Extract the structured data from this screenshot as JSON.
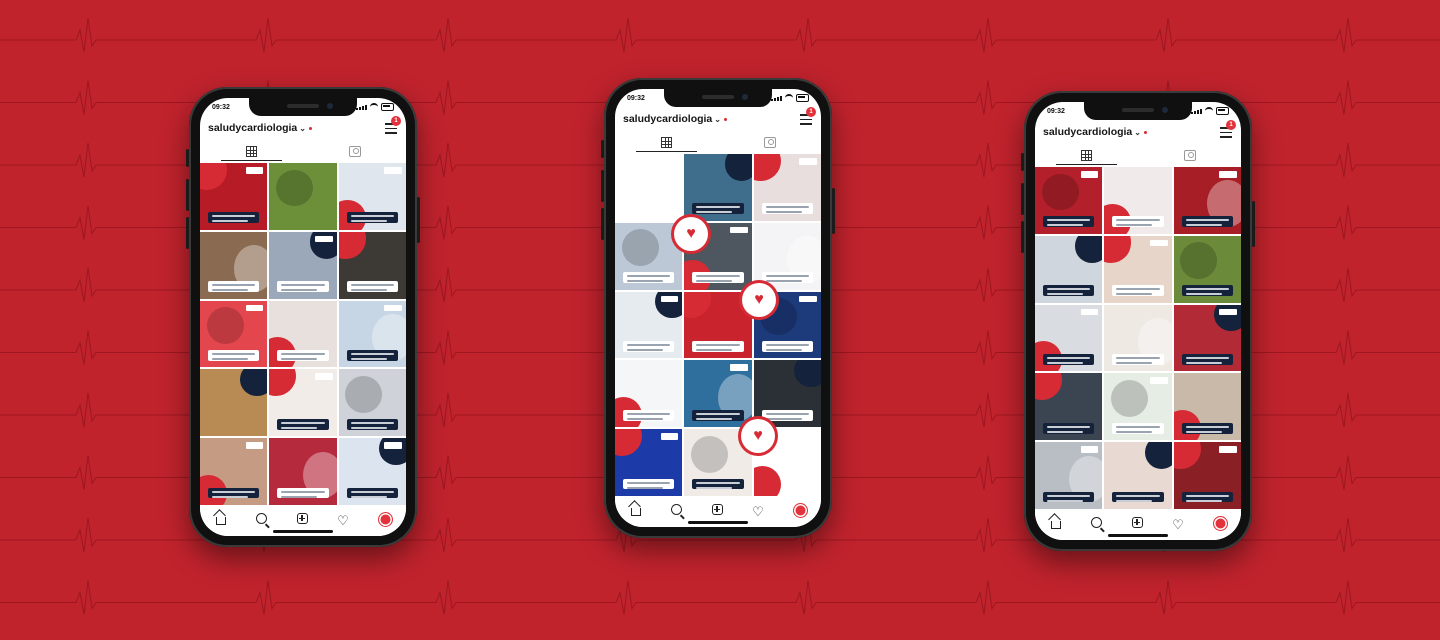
{
  "colors": {
    "background": "#c1232d",
    "accent": "#d62b34",
    "navy": "#14233b"
  },
  "phones": [
    {
      "time": "09:32",
      "username": "saludycardiologia",
      "notification_count": "1",
      "tabs": [
        "grid-icon",
        "tagged-icon"
      ],
      "nav": [
        "home-icon",
        "search-icon",
        "add-icon",
        "heart-icon",
        "profile-icon"
      ],
      "posts": [
        {
          "bg": "#b71c26",
          "cap": "dark"
        },
        {
          "bg": "#6c8f3a",
          "cap": "none"
        },
        {
          "bg": "#dfe6ee",
          "cap": "dark"
        },
        {
          "bg": "#8a6a50",
          "cap": "white"
        },
        {
          "bg": "#9aa8ba",
          "cap": "white"
        },
        {
          "bg": "#3d3a36",
          "cap": "white"
        },
        {
          "bg": "#e4464e",
          "cap": "white"
        },
        {
          "bg": "#e7e0dc",
          "cap": "white"
        },
        {
          "bg": "#c7d6e4",
          "cap": "dark"
        },
        {
          "bg": "#b88a54",
          "cap": "none"
        },
        {
          "bg": "#f1ece8",
          "cap": "dark"
        },
        {
          "bg": "#cfd3d9",
          "cap": "dark"
        },
        {
          "bg": "#c59b84",
          "cap": "dark"
        },
        {
          "bg": "#b52a3c",
          "cap": "white"
        },
        {
          "bg": "#dce5ef",
          "cap": "dark"
        }
      ]
    },
    {
      "time": "09:32",
      "username": "saludycardiologia",
      "notification_count": "1",
      "tabs": [
        "grid-icon",
        "tagged-icon"
      ],
      "nav": [
        "home-icon",
        "search-icon",
        "add-icon",
        "heart-icon",
        "profile-icon"
      ],
      "posts": [
        {
          "bg": "#ffffff",
          "cap": "none"
        },
        {
          "bg": "#3f6d8c",
          "cap": "dark"
        },
        {
          "bg": "#e9dede",
          "cap": "white"
        },
        {
          "bg": "#bcc8d6",
          "cap": "white"
        },
        {
          "bg": "#4e565f",
          "cap": "white"
        },
        {
          "bg": "#f4f4f6",
          "cap": "white"
        },
        {
          "bg": "#e6ebef",
          "cap": "white"
        },
        {
          "bg": "#c9232d",
          "cap": "white"
        },
        {
          "bg": "#1d3a7a",
          "cap": "white"
        },
        {
          "bg": "#f4f6f8",
          "cap": "white"
        },
        {
          "bg": "#2f6f9d",
          "cap": "dark"
        },
        {
          "bg": "#2b2f36",
          "cap": "white"
        },
        {
          "bg": "#1c3aa8",
          "cap": "white"
        },
        {
          "bg": "#f0ebe7",
          "cap": "dark"
        },
        {
          "bg": "#ffffff",
          "cap": "none"
        }
      ]
    },
    {
      "time": "09:32",
      "username": "saludycardiologia",
      "notification_count": "1",
      "tabs": [
        "grid-icon",
        "tagged-icon"
      ],
      "nav": [
        "home-icon",
        "search-icon",
        "add-icon",
        "heart-icon",
        "profile-icon"
      ],
      "posts": [
        {
          "bg": "#b3202b",
          "cap": "dark"
        },
        {
          "bg": "#f0eaea",
          "cap": "white"
        },
        {
          "bg": "#a81e26",
          "cap": "dark"
        },
        {
          "bg": "#cfd6dd",
          "cap": "dark"
        },
        {
          "bg": "#e8d5ca",
          "cap": "white"
        },
        {
          "bg": "#6b8a3a",
          "cap": "dark"
        },
        {
          "bg": "#d9dde2",
          "cap": "dark"
        },
        {
          "bg": "#efe9e4",
          "cap": "white"
        },
        {
          "bg": "#b22a35",
          "cap": "dark"
        },
        {
          "bg": "#3b4552",
          "cap": "dark"
        },
        {
          "bg": "#e6ede5",
          "cap": "white"
        },
        {
          "bg": "#c9b9a8",
          "cap": "dark"
        },
        {
          "bg": "#b9bec5",
          "cap": "dark"
        },
        {
          "bg": "#e8d9d2",
          "cap": "dark"
        },
        {
          "bg": "#8a1f26",
          "cap": "dark"
        }
      ]
    }
  ]
}
